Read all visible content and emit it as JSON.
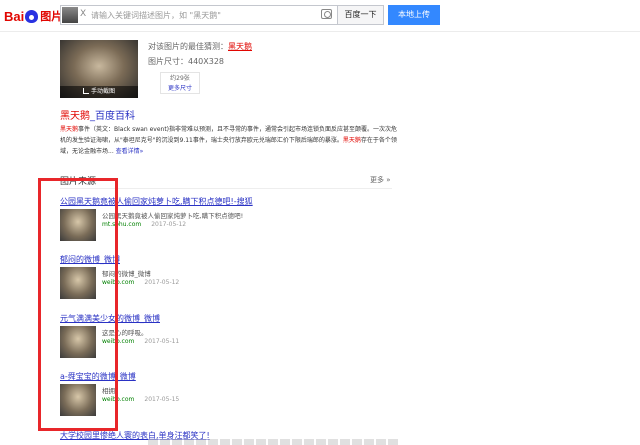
{
  "logo": {
    "text": "Bai",
    "suffix": "图片"
  },
  "search": {
    "placeholder": "请输入关键词描述图片，如 \"黑天鹅\"",
    "close": "X",
    "button": "百度一下",
    "upload": "本地上传"
  },
  "guess": {
    "label": "对该图片的最佳猜测：",
    "keyword": "黑天鹅",
    "size_label": "图片尺寸：",
    "size_value": "440X328",
    "crop_label": "手动截图",
    "count": "约29张",
    "more_sizes": "更多尺寸"
  },
  "baike": {
    "keyword": "黑天鹅",
    "title_suffix": "_百度百科",
    "text_kw": "黑天鹅",
    "text_1": "事件（英文：Black swan event)指非常难以预测，且不寻常的事件，通常会引起市场连锁负面反应甚至颠覆。一次次危机的发生验证海啸，从\"泰坦尼克号\"的沉没到9.11事件，瑞士央行放弃欧元兑瑞郎汇价下限后瑞郎的暴涨。",
    "text_kw2": "黑天鹅",
    "text_2": "存在于各个领域，无论金融市场... ",
    "detail": "查看详情»"
  },
  "sources": {
    "title": "图片来源",
    "more": "更多 »",
    "items": [
      {
        "title": "公园黑天鹅竟被人偷回家炖萝卜吃,瞒下积点德吧!-搜狐",
        "desc": "公园黑天鹅竟被人偷回家炖萝卜吃,瞒下积点德吧!",
        "url": "mt.sohu.com",
        "date": "2017-05-12"
      },
      {
        "title": "郁闷的微博_微博",
        "desc": "郁闷的微博_微博",
        "url": "weibo.com",
        "date": "2017-05-12"
      },
      {
        "title": "元气满满美少女的微博_微博",
        "desc": "这是心的呼吸。",
        "url": "weibo.com",
        "date": "2017-05-11"
      },
      {
        "title": "a-舜宝宝的微博_微博",
        "desc": "相拥",
        "url": "weibo.com",
        "date": "2017-05-15"
      }
    ],
    "bottom_title": "大学校园里惨绝人寰的表白,单身汪都笑了!"
  }
}
